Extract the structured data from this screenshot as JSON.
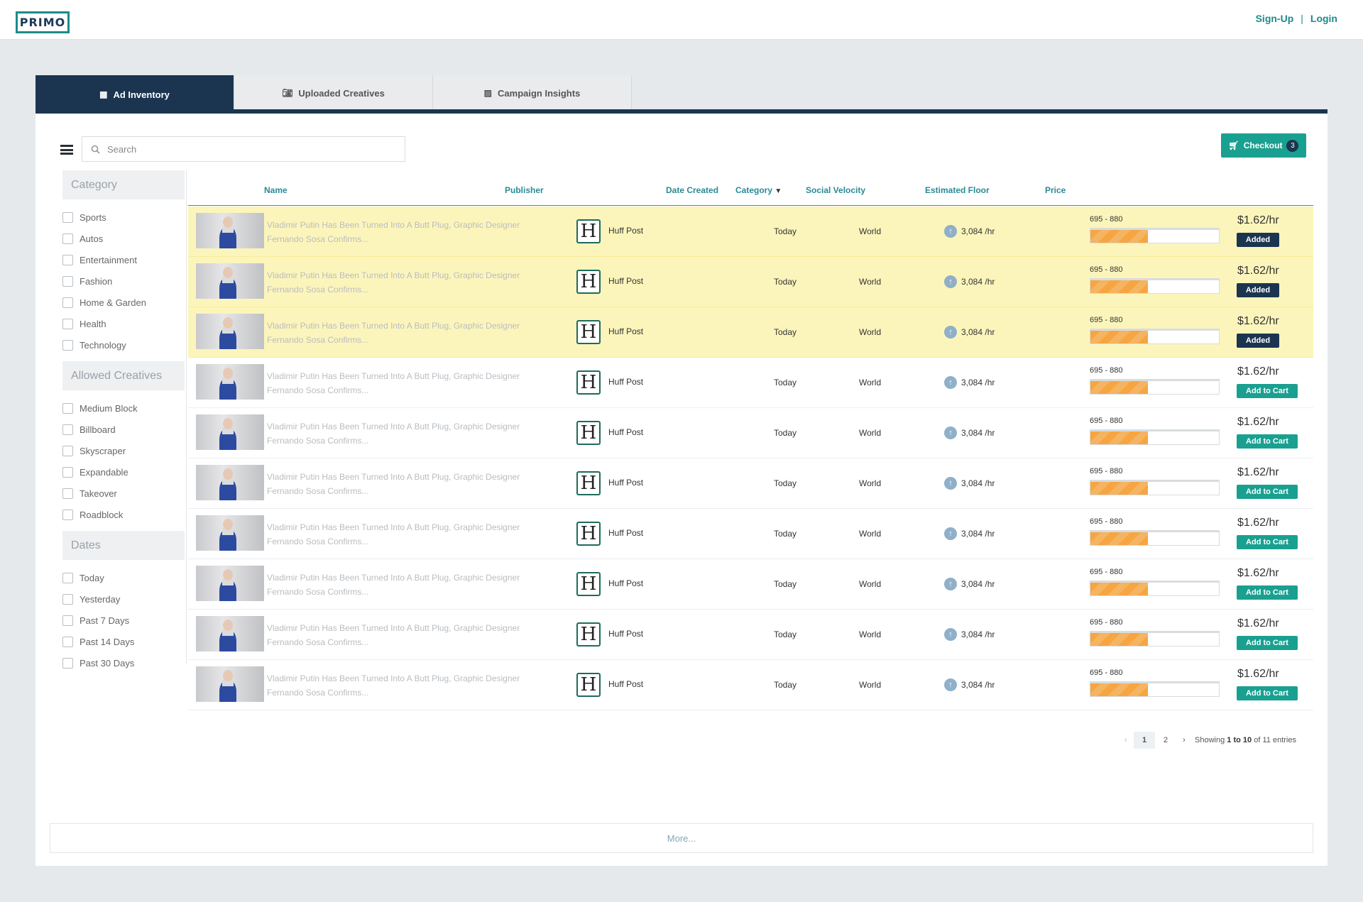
{
  "app": {
    "logo": "PRIMO",
    "signup": "Sign-Up",
    "separator": "|",
    "login": "Login"
  },
  "tabs": [
    {
      "label": "Ad Inventory",
      "icon": "table-icon",
      "active": true
    },
    {
      "label": "Uploaded Creatives",
      "icon": "camera-icon",
      "active": false
    },
    {
      "label": "Campaign Insights",
      "icon": "chart-icon",
      "active": false
    }
  ],
  "search": {
    "placeholder": "Search",
    "value": ""
  },
  "checkout": {
    "label": "Checkout",
    "count": "3"
  },
  "filters": {
    "category": {
      "title": "Category",
      "items": [
        "Sports",
        "Autos",
        "Entertainment",
        "Fashion",
        "Home & Garden",
        "Health",
        "Technology"
      ]
    },
    "creatives": {
      "title": "Allowed Creatives",
      "items": [
        "Medium Block",
        "Billboard",
        "Skyscraper",
        "Expandable",
        "Takeover",
        "Roadblock"
      ]
    },
    "dates": {
      "title": "Dates",
      "items": [
        "Today",
        "Yesterday",
        "Past 7 Days",
        "Past 14 Days",
        "Past 30 Days"
      ]
    }
  },
  "table": {
    "columns": {
      "name": "Name",
      "publisher": "Publisher",
      "date": "Date Created",
      "category": "Category",
      "velocity": "Social Velocity",
      "floor": "Estimated Floor",
      "price": "Price"
    },
    "rows": [
      {
        "name": "Vladimir Putin Has Been Turned Into A Butt Plug, Graphic Designer Fernando Sosa Confirms...",
        "publisher_logo": "H",
        "publisher": "Huff Post",
        "date": "Today",
        "category": "World",
        "velocity": "3,084 /hr",
        "floor": "695 - 880",
        "floor_fill": 0.45,
        "price": "$1.62/hr",
        "status": "Added",
        "added": true
      },
      {
        "name": "Vladimir Putin Has Been Turned Into A Butt Plug, Graphic Designer Fernando Sosa Confirms...",
        "publisher_logo": "H",
        "publisher": "Huff Post",
        "date": "Today",
        "category": "World",
        "velocity": "3,084 /hr",
        "floor": "695 - 880",
        "floor_fill": 0.45,
        "price": "$1.62/hr",
        "status": "Added",
        "added": true
      },
      {
        "name": "Vladimir Putin Has Been Turned Into A Butt Plug, Graphic Designer Fernando Sosa Confirms...",
        "publisher_logo": "H",
        "publisher": "Huff Post",
        "date": "Today",
        "category": "World",
        "velocity": "3,084 /hr",
        "floor": "695 - 880",
        "floor_fill": 0.45,
        "price": "$1.62/hr",
        "status": "Added",
        "added": true
      },
      {
        "name": "Vladimir Putin Has Been Turned Into A Butt Plug, Graphic Designer Fernando Sosa Confirms...",
        "publisher_logo": "H",
        "publisher": "Huff Post",
        "date": "Today",
        "category": "World",
        "velocity": "3,084 /hr",
        "floor": "695 - 880",
        "floor_fill": 0.45,
        "price": "$1.62/hr",
        "status": "Add to Cart",
        "added": false
      },
      {
        "name": "Vladimir Putin Has Been Turned Into A Butt Plug, Graphic Designer Fernando Sosa Confirms...",
        "publisher_logo": "H",
        "publisher": "Huff Post",
        "date": "Today",
        "category": "World",
        "velocity": "3,084 /hr",
        "floor": "695 - 880",
        "floor_fill": 0.45,
        "price": "$1.62/hr",
        "status": "Add to Cart",
        "added": false
      },
      {
        "name": "Vladimir Putin Has Been Turned Into A Butt Plug, Graphic Designer Fernando Sosa Confirms...",
        "publisher_logo": "H",
        "publisher": "Huff Post",
        "date": "Today",
        "category": "World",
        "velocity": "3,084 /hr",
        "floor": "695 - 880",
        "floor_fill": 0.45,
        "price": "$1.62/hr",
        "status": "Add to Cart",
        "added": false
      },
      {
        "name": "Vladimir Putin Has Been Turned Into A Butt Plug, Graphic Designer Fernando Sosa Confirms...",
        "publisher_logo": "H",
        "publisher": "Huff Post",
        "date": "Today",
        "category": "World",
        "velocity": "3,084 /hr",
        "floor": "695 - 880",
        "floor_fill": 0.45,
        "price": "$1.62/hr",
        "status": "Add to Cart",
        "added": false
      },
      {
        "name": "Vladimir Putin Has Been Turned Into A Butt Plug, Graphic Designer Fernando Sosa Confirms...",
        "publisher_logo": "H",
        "publisher": "Huff Post",
        "date": "Today",
        "category": "World",
        "velocity": "3,084 /hr",
        "floor": "695 - 880",
        "floor_fill": 0.45,
        "price": "$1.62/hr",
        "status": "Add to Cart",
        "added": false
      },
      {
        "name": "Vladimir Putin Has Been Turned Into A Butt Plug, Graphic Designer Fernando Sosa Confirms...",
        "publisher_logo": "H",
        "publisher": "Huff Post",
        "date": "Today",
        "category": "World",
        "velocity": "3,084 /hr",
        "floor": "695 - 880",
        "floor_fill": 0.45,
        "price": "$1.62/hr",
        "status": "Add to Cart",
        "added": false
      },
      {
        "name": "Vladimir Putin Has Been Turned Into A Butt Plug, Graphic Designer Fernando Sosa Confirms...",
        "publisher_logo": "H",
        "publisher": "Huff Post",
        "date": "Today",
        "category": "World",
        "velocity": "3,084 /hr",
        "floor": "695 - 880",
        "floor_fill": 0.45,
        "price": "$1.62/hr",
        "status": "Add to Cart",
        "added": false
      }
    ]
  },
  "pagination": {
    "prev": "‹",
    "pages": [
      "1",
      "2"
    ],
    "current": "1",
    "next": "›",
    "info_prefix": "Showing",
    "from": "1",
    "to_word": "to",
    "to": "10",
    "of_word": "of",
    "total": "11",
    "suffix": "entries"
  },
  "more": {
    "label": "More..."
  },
  "colors": {
    "navy": "#1b3550",
    "teal": "#1aa090",
    "added_row": "#fcf5bb",
    "floor_orange": "#f7a540"
  }
}
